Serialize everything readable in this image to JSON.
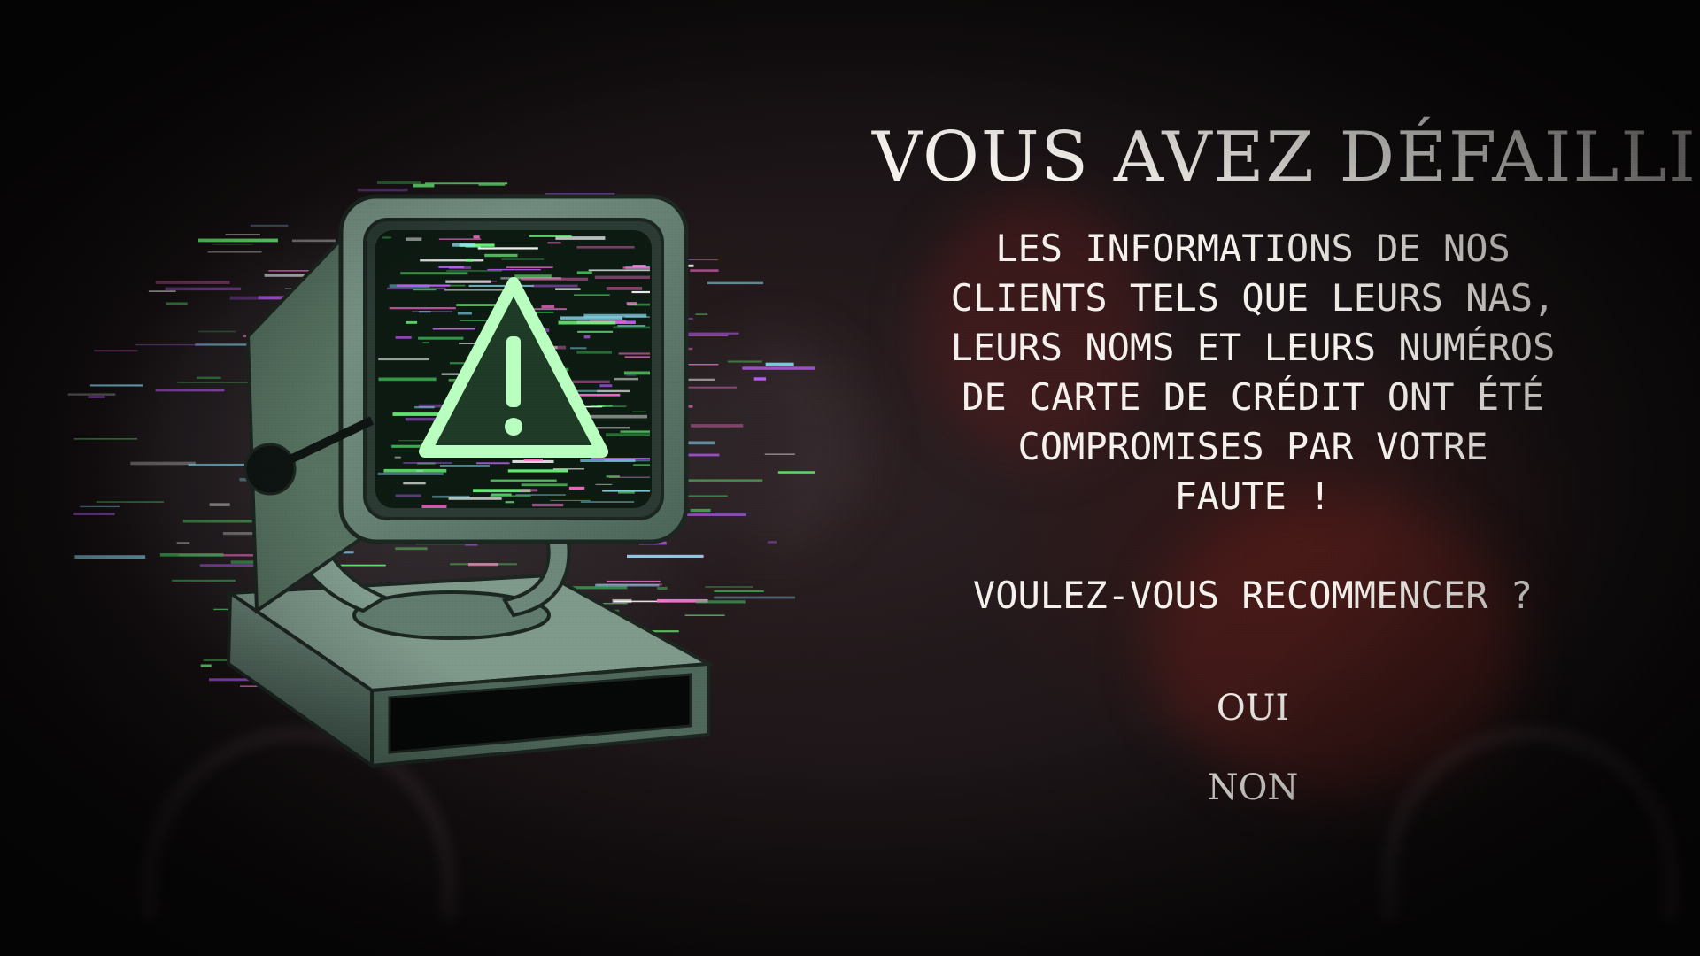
{
  "screen": {
    "title": "VOUS AVEZ DÉFAILLI",
    "message_lines": [
      "LES INFORMATIONS DE NOS",
      "CLIENTS TELS QUE LEURS NAS,",
      "LEURS NOMS ET LEURS NUMÉROS",
      "DE CARTE DE CRÉDIT ONT ÉTÉ",
      "COMPROMISES PAR VOTRE",
      "FAUTE !"
    ],
    "question": "VOULEZ-VOUS RECOMMENCER ?",
    "choices": {
      "yes": "OUI",
      "no": "NON"
    }
  },
  "illustration": {
    "subject": "glitched-computer-monitor",
    "screen_icon": "warning-triangle-icon"
  },
  "colors": {
    "text": "#f4f1ec",
    "background": "#1a1315",
    "monitor_body": "#5f7a6d",
    "monitor_dark": "#2c3b34",
    "glitch_green": "#6dff7a",
    "glitch_magenta": "#c060ff"
  }
}
